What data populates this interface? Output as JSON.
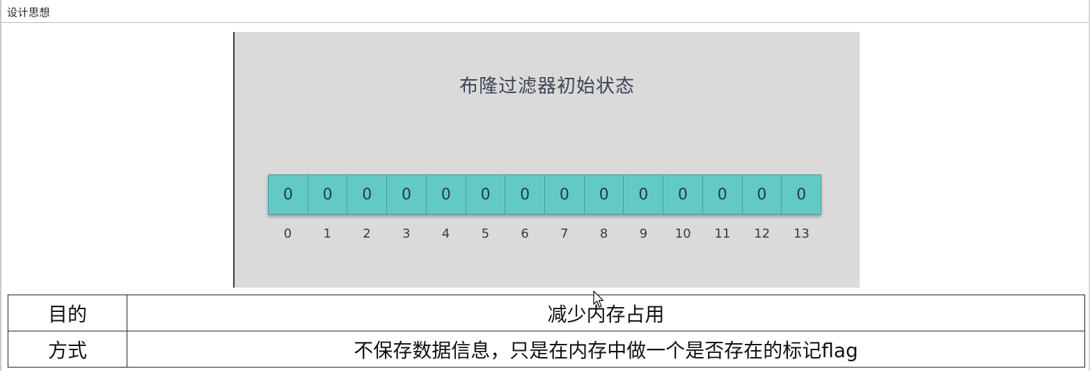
{
  "header": {
    "title": "设计思想"
  },
  "diagram": {
    "title": "布隆过滤器初始状态",
    "bits": [
      "0",
      "0",
      "0",
      "0",
      "0",
      "0",
      "0",
      "0",
      "0",
      "0",
      "0",
      "0",
      "0",
      "0"
    ],
    "indices": [
      "0",
      "1",
      "2",
      "3",
      "4",
      "5",
      "6",
      "7",
      "8",
      "9",
      "10",
      "11",
      "12",
      "13"
    ],
    "colors": {
      "cell": "#63c9c4",
      "background": "#dadada"
    }
  },
  "table": {
    "rows": [
      {
        "label": "目的",
        "value": "减少内存占用"
      },
      {
        "label": "方式",
        "value": "不保存数据信息，只是在内存中做一个是否存在的标记flag"
      }
    ]
  }
}
